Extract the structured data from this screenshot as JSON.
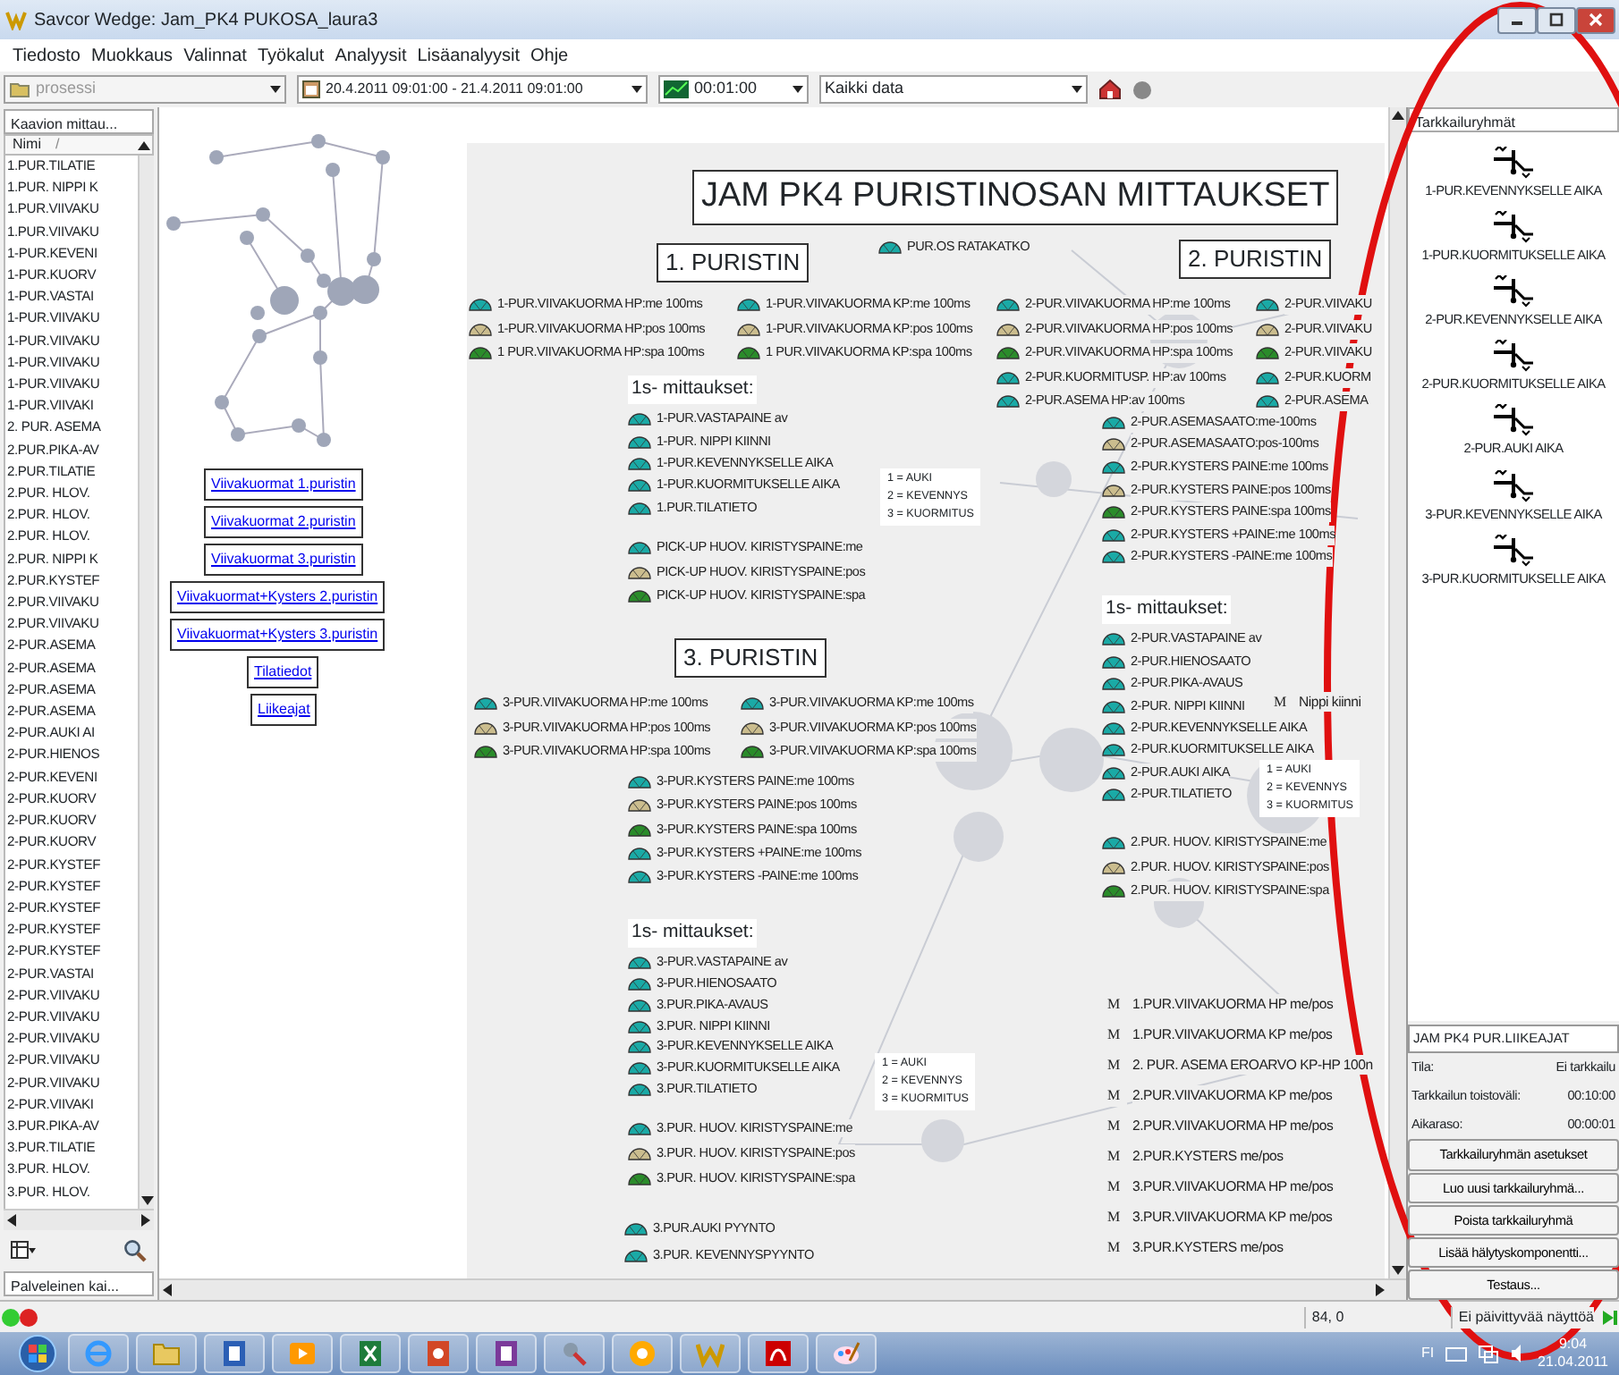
{
  "window": {
    "title": "Savcor Wedge: Jam_PK4 PUKOSA_laura3"
  },
  "menu": [
    "Tiedosto",
    "Muokkaus",
    "Valinnat",
    "Työkalut",
    "Analyysit",
    "Lisäanalyysit",
    "Ohje"
  ],
  "toolbar": {
    "process": {
      "value": "prosessi",
      "disabled": true
    },
    "period": "20.4.2011 09:01:00 - 21.4.2011 09:01:00",
    "interval": "00:01:00",
    "data_filter": "Kaikki data"
  },
  "left_panel": {
    "tab": "Kaavion mittau...",
    "column": "Nimi",
    "sort_mark": "/",
    "bottom_tab": "Palveleinen kai...",
    "items": [
      "1.PUR.TILATIE",
      "1.PUR. NIPPI K",
      "1.PUR.VIIVAKU",
      "1.PUR.VIIVAKU",
      "1-PUR.KEVENI",
      "1-PUR.KUORV",
      "1-PUR.VASTAI",
      "1-PUR.VIIVAKU",
      "1-PUR.VIIVAKU",
      "1-PUR.VIIVAKU",
      "1-PUR.VIIVAKU",
      "1-PUR.VIIVAKI",
      "2. PUR. ASEMA",
      "2.PUR.PIKA-AV",
      "2.PUR.TILATIE",
      "2.PUR. HLOV.",
      "2.PUR. HLOV.",
      "2.PUR. HLOV.",
      "2.PUR. NIPPI K",
      "2.PUR.KYSTEF",
      "2.PUR.VIIVAKU",
      "2.PUR.VIIVAKU",
      "2-PUR.ASEMA",
      "2-PUR.ASEMA",
      "2-PUR.ASEMA",
      "2-PUR.ASEMA",
      "2-PUR.AUKI AI",
      "2-PUR.HIENOS",
      "2-PUR.KEVENI",
      "2-PUR.KUORV",
      "2-PUR.KUORV",
      "2-PUR.KUORV",
      "2-PUR.KYSTEF",
      "2-PUR.KYSTEF",
      "2-PUR.KYSTEF",
      "2-PUR.KYSTEF",
      "2-PUR.KYSTEF",
      "2-PUR.VASTAI",
      "2-PUR.VIIVAKU",
      "2-PUR.VIIVAKU",
      "2-PUR.VIIVAKU",
      "2-PUR.VIIVAKU",
      "2-PUR.VIIVAKU",
      "2-PUR.VIIVAKI",
      "3.PUR.PIKA-AV",
      "3.PUR.TILATIE",
      "3.PUR. HLOV.",
      "3.PUR. HLOV."
    ]
  },
  "links": [
    "Viivakuormat 1.puristin",
    "Viivakuormat 2.puristin",
    "Viivakuormat 3.puristin",
    "Viivakuormat+Kysters 2.puristin",
    "Viivakuormat+Kysters 3.puristin",
    "Tilatiedot",
    "Liikeajat"
  ],
  "diagram": {
    "title": "JAM PK4 PURISTINOSAN MITTAUKSET",
    "headings": [
      "1. PURISTIN",
      "2. PURISTIN",
      "3. PURISTIN"
    ],
    "blocks": [
      {
        "items": [
          {
            "kind": "gauge",
            "color": "#1aaaa6",
            "label": "PUR.OS RATAKATKO"
          }
        ]
      },
      {
        "items": [
          {
            "kind": "gauge",
            "color": "#1aaaa6",
            "label": "1-PUR.VIIVAKUORMA HP:me 100ms"
          },
          {
            "kind": "gauge",
            "color": "#cbbd8e",
            "label": "1-PUR.VIIVAKUORMA HP:pos 100ms"
          },
          {
            "kind": "gauge",
            "color": "#2a8c2a",
            "label": "1 PUR.VIIVAKUORMA HP:spa 100ms"
          }
        ]
      },
      {
        "items": [
          {
            "kind": "gauge",
            "color": "#1aaaa6",
            "label": "1-PUR.VIIVAKUORMA KP:me 100ms"
          },
          {
            "kind": "gauge",
            "color": "#cbbd8e",
            "label": "1-PUR.VIIVAKUORMA KP:pos 100ms"
          },
          {
            "kind": "gauge",
            "color": "#2a8c2a",
            "label": "1 PUR.VIIVAKUORMA KP:spa 100ms"
          }
        ]
      },
      {
        "items": [
          {
            "kind": "gauge",
            "color": "#1aaaa6",
            "label": "2-PUR.VIIVAKUORMA HP:me 100ms"
          },
          {
            "kind": "gauge",
            "color": "#cbbd8e",
            "label": "2-PUR.VIIVAKUORMA HP:pos 100ms"
          },
          {
            "kind": "gauge",
            "color": "#2a8c2a",
            "label": "2-PUR.VIIVAKUORMA HP:spa 100ms"
          },
          {
            "kind": "gauge",
            "color": "#1aaaa6",
            "label": "2-PUR.KUORMITUSP. HP:av 100ms"
          },
          {
            "kind": "gauge",
            "color": "#1aaaa6",
            "label": "2-PUR.ASEMA HP:av 100ms"
          }
        ]
      },
      {
        "items": [
          {
            "kind": "gauge",
            "color": "#1aaaa6",
            "label": "2-PUR.VIIVAKU"
          },
          {
            "kind": "gauge",
            "color": "#cbbd8e",
            "label": "2-PUR.VIIVAKU"
          },
          {
            "kind": "gauge",
            "color": "#2a8c2a",
            "label": "2-PUR.VIIVAKU"
          },
          {
            "kind": "gauge",
            "color": "#1aaaa6",
            "label": "2-PUR.KUORM"
          },
          {
            "kind": "gauge",
            "color": "#1aaaa6",
            "label": "2-PUR.ASEMA"
          }
        ]
      },
      {
        "heading": "1s- mittaukset:",
        "items": [
          {
            "kind": "gauge",
            "color": "#1aaaa6",
            "label": "1-PUR.VASTAPAINE av"
          },
          {
            "kind": "gauge",
            "color": "#1aaaa6",
            "label": "1-PUR. NIPPI KIINNI"
          },
          {
            "kind": "gauge",
            "color": "#1aaaa6",
            "label": "1-PUR.KEVENNYKSELLE AIKA"
          },
          {
            "kind": "gauge",
            "color": "#1aaaa6",
            "label": "1-PUR.KUORMITUKSELLE AIKA"
          },
          {
            "kind": "gauge",
            "color": "#1aaaa6",
            "label": "1.PUR.TILATIETO"
          }
        ]
      },
      {
        "items": [
          {
            "kind": "gauge",
            "color": "#1aaaa6",
            "label": "PICK-UP HUOV. KIRISTYSPAINE:me"
          },
          {
            "kind": "gauge",
            "color": "#cbbd8e",
            "label": "PICK-UP HUOV. KIRISTYSPAINE:pos"
          },
          {
            "kind": "gauge",
            "color": "#2a8c2a",
            "label": "PICK-UP HUOV. KIRISTYSPAINE:spa"
          }
        ]
      },
      {
        "items": [
          {
            "kind": "gauge",
            "color": "#1aaaa6",
            "label": "3-PUR.VIIVAKUORMA HP:me 100ms"
          },
          {
            "kind": "gauge",
            "color": "#cbbd8e",
            "label": "3-PUR.VIIVAKUORMA HP:pos 100ms"
          },
          {
            "kind": "gauge",
            "color": "#2a8c2a",
            "label": "3-PUR.VIIVAKUORMA HP:spa 100ms"
          }
        ]
      },
      {
        "items": [
          {
            "kind": "gauge",
            "color": "#1aaaa6",
            "label": "3-PUR.VIIVAKUORMA KP:me 100ms"
          },
          {
            "kind": "gauge",
            "color": "#cbbd8e",
            "label": "3-PUR.VIIVAKUORMA KP:pos 100ms"
          },
          {
            "kind": "gauge",
            "color": "#2a8c2a",
            "label": "3-PUR.VIIVAKUORMA KP:spa 100ms"
          }
        ]
      },
      {
        "items": [
          {
            "kind": "gauge",
            "color": "#1aaaa6",
            "label": "3-PUR.KYSTERS PAINE:me 100ms"
          },
          {
            "kind": "gauge",
            "color": "#cbbd8e",
            "label": "3-PUR.KYSTERS PAINE:pos 100ms"
          },
          {
            "kind": "gauge",
            "color": "#2a8c2a",
            "label": "3-PUR.KYSTERS PAINE:spa 100ms"
          },
          {
            "kind": "gauge",
            "color": "#1aaaa6",
            "label": "3-PUR.KYSTERS +PAINE:me 100ms"
          },
          {
            "kind": "gauge",
            "color": "#1aaaa6",
            "label": "3-PUR.KYSTERS -PAINE:me 100ms"
          }
        ]
      },
      {
        "heading": "1s- mittaukset:",
        "items": [
          {
            "kind": "gauge",
            "color": "#1aaaa6",
            "label": "3-PUR.VASTAPAINE av"
          },
          {
            "kind": "gauge",
            "color": "#1aaaa6",
            "label": "3-PUR.HIENOSAATO"
          },
          {
            "kind": "gauge",
            "color": "#1aaaa6",
            "label": "3.PUR.PIKA-AVAUS"
          },
          {
            "kind": "gauge",
            "color": "#1aaaa6",
            "label": "3.PUR. NIPPI KIINNI"
          },
          {
            "kind": "gauge",
            "color": "#1aaaa6",
            "label": "3-PUR.KEVENNYKSELLE AIKA"
          },
          {
            "kind": "gauge",
            "color": "#1aaaa6",
            "label": "3-PUR.KUORMITUKSELLE AIKA"
          },
          {
            "kind": "gauge",
            "color": "#1aaaa6",
            "label": "3.PUR.TILATIETO"
          }
        ]
      },
      {
        "items": [
          {
            "kind": "gauge",
            "color": "#1aaaa6",
            "label": "3.PUR. HUOV. KIRISTYSPAINE:me"
          },
          {
            "kind": "gauge",
            "color": "#cbbd8e",
            "label": "3.PUR. HUOV. KIRISTYSPAINE:pos"
          },
          {
            "kind": "gauge",
            "color": "#2a8c2a",
            "label": "3.PUR. HUOV. KIRISTYSPAINE:spa"
          }
        ]
      },
      {
        "items": [
          {
            "kind": "gauge",
            "color": "#1aaaa6",
            "label": "3.PUR.AUKI PYYNTO"
          },
          {
            "kind": "gauge",
            "color": "#1aaaa6",
            "label": "3.PUR. KEVENNYSPYYNTO"
          }
        ]
      },
      {
        "items": [
          {
            "kind": "gauge",
            "color": "#1aaaa6",
            "label": "2-PUR.ASEMASAATO:me-100ms"
          },
          {
            "kind": "gauge",
            "color": "#cbbd8e",
            "label": "2-PUR.ASEMASAATO:pos-100ms"
          },
          {
            "kind": "gauge",
            "color": "#1aaaa6",
            "label": "2-PUR.KYSTERS PAINE:me 100ms"
          },
          {
            "kind": "gauge",
            "color": "#cbbd8e",
            "label": "2-PUR.KYSTERS PAINE:pos 100ms"
          },
          {
            "kind": "gauge",
            "color": "#2a8c2a",
            "label": "2-PUR.KYSTERS PAINE:spa 100ms"
          },
          {
            "kind": "gauge",
            "color": "#1aaaa6",
            "label": "2-PUR.KYSTERS +PAINE:me 100ms"
          },
          {
            "kind": "gauge",
            "color": "#1aaaa6",
            "label": "2-PUR.KYSTERS -PAINE:me 100ms"
          }
        ]
      },
      {
        "heading": "1s- mittaukset:",
        "items": [
          {
            "kind": "gauge",
            "color": "#1aaaa6",
            "label": "2-PUR.VASTAPAINE av"
          },
          {
            "kind": "gauge",
            "color": "#1aaaa6",
            "label": "2-PUR.HIENOSAATO"
          },
          {
            "kind": "gauge",
            "color": "#1aaaa6",
            "label": "2-PUR.PIKA-AVAUS"
          },
          {
            "kind": "gauge",
            "color": "#1aaaa6",
            "label": "2-PUR. NIPPI KIINNI"
          },
          {
            "kind": "gauge",
            "color": "#1aaaa6",
            "label": "2-PUR.KEVENNYKSELLE AIKA"
          },
          {
            "kind": "gauge",
            "color": "#1aaaa6",
            "label": "2-PUR.KUORMITUKSELLE AIKA"
          },
          {
            "kind": "gauge",
            "color": "#1aaaa6",
            "label": "2-PUR.AUKI AIKA"
          },
          {
            "kind": "gauge",
            "color": "#1aaaa6",
            "label": "2-PUR.TILATIETO"
          }
        ]
      },
      {
        "items": [
          {
            "kind": "calc",
            "symbol": "M",
            "label": "Nippi kiinni"
          }
        ]
      },
      {
        "items": [
          {
            "kind": "gauge",
            "color": "#1aaaa6",
            "label": "2.PUR. HUOV. KIRISTYSPAINE:me"
          },
          {
            "kind": "gauge",
            "color": "#cbbd8e",
            "label": "2.PUR. HUOV. KIRISTYSPAINE:pos"
          },
          {
            "kind": "gauge",
            "color": "#2a8c2a",
            "label": "2.PUR. HUOV. KIRISTYSPAINE:spa"
          }
        ]
      },
      {
        "items": [
          {
            "kind": "calc",
            "symbol": "M",
            "label": "1.PUR.VIIVAKUORMA HP me/pos"
          },
          {
            "kind": "calc",
            "symbol": "M",
            "label": "1.PUR.VIIVAKUORMA KP me/pos"
          },
          {
            "kind": "calc",
            "symbol": "M",
            "label": "2. PUR. ASEMA EROARVO KP-HP 100n"
          },
          {
            "kind": "calc",
            "symbol": "M",
            "label": "2.PUR.VIIVAKUORMA KP me/pos"
          },
          {
            "kind": "calc",
            "symbol": "M",
            "label": "2.PUR.VIIVAKUORMA HP me/pos"
          },
          {
            "kind": "calc",
            "symbol": "M",
            "label": "2.PUR.KYSTERS me/pos"
          },
          {
            "kind": "calc",
            "symbol": "M",
            "label": "3.PUR.VIIVAKUORMA HP me/pos"
          },
          {
            "kind": "calc",
            "symbol": "M",
            "label": "3.PUR.VIIVAKUORMA KP me/pos"
          },
          {
            "kind": "calc",
            "symbol": "M",
            "label": "3.PUR.KYSTERS me/pos"
          }
        ]
      }
    ],
    "legends": [
      [
        "1 = AUKI",
        "2 = KEVENNYS",
        "3 = KUORMITUS"
      ],
      [
        "1 = AUKI",
        "2 = KEVENNYS",
        "3 = KUORMITUS"
      ],
      [
        "1 = AUKI",
        "2 = KEVENNYS",
        "3 = KUORMITUS"
      ]
    ]
  },
  "side_panel": {
    "title": "Tarkkailuryhmät",
    "groups": [
      "1-PUR.KEVENNYKSELLE AIKA",
      "1-PUR.KUORMITUKSELLE AIKA",
      "2-PUR.KEVENNYKSELLE AIKA",
      "2-PUR.KUORMITUKSELLE AIKA",
      "2-PUR.AUKI AIKA",
      "3-PUR.KEVENNYKSELLE AIKA",
      "3-PUR.KUORMITUKSELLE AIKA"
    ],
    "selected_group": "JAM PK4 PUR.LIIKEAJAT",
    "details": [
      {
        "label": "Tila:",
        "value": "Ei tarkkailu"
      },
      {
        "label": "Tarkkailun toistoväli:",
        "value": "00:10:00"
      },
      {
        "label": "Aikaraso:",
        "value": "00:00:01"
      }
    ],
    "buttons": [
      "Tarkkailuryhmän asetukset",
      "Luo uusi tarkkailuryhmä...",
      "Poista tarkkailuryhmä",
      "Lisää hälytyskomponentti...",
      "Testaus..."
    ]
  },
  "status_bar": {
    "position": "84, 0",
    "message": "Ei päivittyvää näyttöä"
  },
  "taskbar": {
    "language": "FI",
    "time": "9:04",
    "date": "21.04.2011"
  }
}
